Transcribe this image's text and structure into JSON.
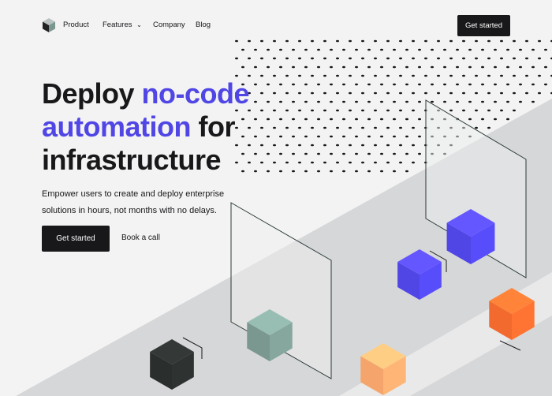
{
  "nav": {
    "items": [
      "Product",
      "Features",
      "Company",
      "Blog"
    ],
    "cta": "Get started"
  },
  "hero": {
    "title_1": "Deploy ",
    "title_hl1": "no-code",
    "title_hl2": "automation",
    "title_2": " for",
    "title_3": "infrastructure",
    "subtitle": "Empower users to create and deploy enterprise solutions in hours, not months with no delays.",
    "primary_button": "Get started",
    "secondary_button": "Book a call"
  },
  "colors": {
    "accent": "#5046e5",
    "dark": "#18181b",
    "orange": "#f26a2e",
    "peach": "#f5a56b",
    "teal": "#7a9890",
    "background": "#f3f3f3"
  },
  "icons": {
    "logo": "cube-logo-icon",
    "features_dropdown": "chevron-down-icon"
  }
}
